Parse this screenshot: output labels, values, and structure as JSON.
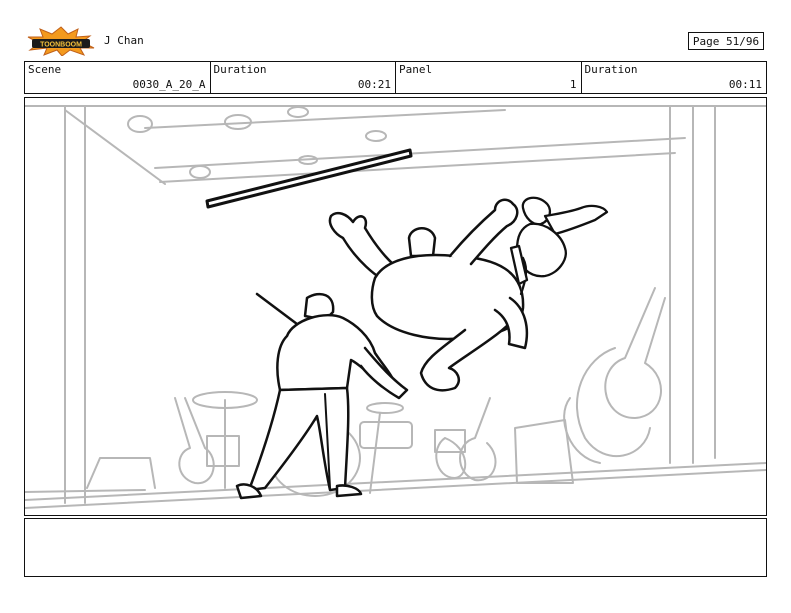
{
  "header": {
    "logo_text": "TOONBOOM",
    "show_title": "J Chan",
    "page_label": "Page 51/96"
  },
  "meta": [
    {
      "label": "Scene",
      "value": "0030_A_20_A"
    },
    {
      "label": "Duration",
      "value": "00:21"
    },
    {
      "label": "Panel",
      "value": "1"
    },
    {
      "label": "Duration",
      "value": "00:11"
    }
  ],
  "panel": {
    "image_name": "storyboard-sketch"
  },
  "caption": {
    "text": ""
  }
}
